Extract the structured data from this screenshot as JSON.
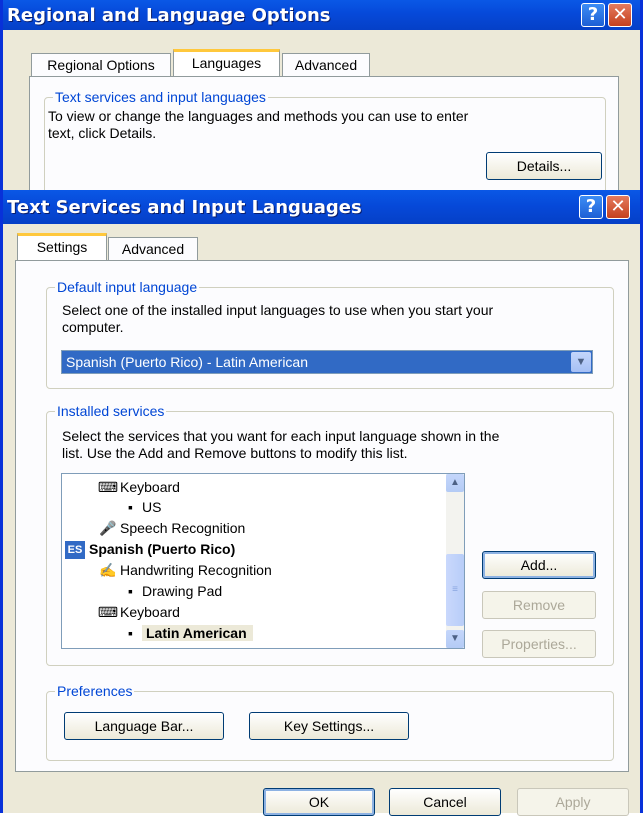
{
  "back_window": {
    "title": "Regional and Language Options",
    "help_glyph": "?",
    "close_glyph": "✕",
    "tabs": [
      {
        "label": "Regional Options"
      },
      {
        "label": "Languages"
      },
      {
        "label": "Advanced"
      }
    ],
    "active_tab": "Languages",
    "group_title": "Text services and input languages",
    "group_text_line1": "To view or change the languages and methods you can use to enter",
    "group_text_line2": "text, click Details.",
    "details_button": "Details..."
  },
  "dialog": {
    "title": "Text Services and Input Languages",
    "help_glyph": "?",
    "close_glyph": "✕",
    "tabs": [
      {
        "label": "Settings"
      },
      {
        "label": "Advanced"
      }
    ],
    "active_tab": "Settings",
    "default_input": {
      "title": "Default input language",
      "text_line1": "Select one of the installed input languages to use when you start your",
      "text_line2": "computer.",
      "selected_value": "Spanish (Puerto Rico) - Latin American",
      "arrow_glyph": "▼"
    },
    "installed_services": {
      "title": "Installed services",
      "text_line1": "Select the services that you want for each input language shown in the",
      "text_line2": "list. Use the Add and Remove buttons to modify this list.",
      "items": [
        {
          "label": "Keyboard",
          "icon": "keyboard-icon",
          "glyph": "⌨"
        },
        {
          "label": "US",
          "icon": "bullet"
        },
        {
          "label": "Speech Recognition",
          "icon": "microphone-icon",
          "glyph": "🎤"
        },
        {
          "label": "Spanish (Puerto Rico)",
          "icon": "language-badge",
          "badge": "ES"
        },
        {
          "label": "Handwriting Recognition",
          "icon": "pen-icon",
          "glyph": "✍"
        },
        {
          "label": "Drawing Pad",
          "icon": "bullet"
        },
        {
          "label": "Keyboard",
          "icon": "keyboard-icon",
          "glyph": "⌨"
        },
        {
          "label": "Latin American",
          "icon": "bullet",
          "selected": true
        }
      ],
      "add_button": "Add...",
      "remove_button": "Remove",
      "properties_button": "Properties...",
      "scroll_up_glyph": "▲",
      "scroll_down_glyph": "▼",
      "thumb_grip_glyph": "≡"
    },
    "preferences": {
      "title": "Preferences",
      "language_bar_button": "Language Bar...",
      "key_settings_button": "Key Settings..."
    },
    "ok_button": "OK",
    "cancel_button": "Cancel",
    "apply_button": "Apply"
  },
  "colors": {
    "title_bar": "#0a58e6",
    "window_face": "#ece9d8",
    "selection": "#316ac5",
    "group_title_text": "#0046d5"
  }
}
